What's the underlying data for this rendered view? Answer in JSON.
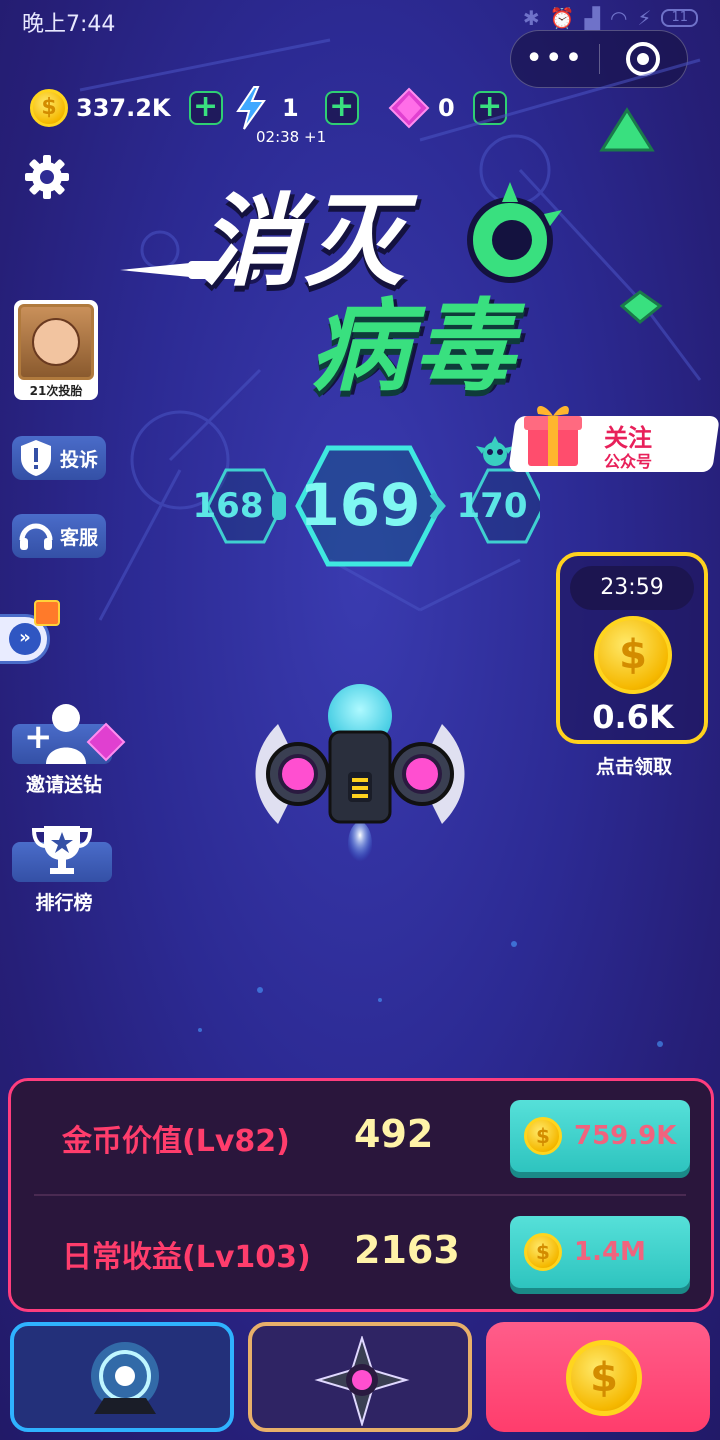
{
  "status_bar": {
    "time": "晚上7:44",
    "battery": "11"
  },
  "capsule": {
    "more": "•••"
  },
  "resources": {
    "coins": "337.2K",
    "energy": "1",
    "energy_timer": "02:38 +1",
    "gems": "0"
  },
  "title": {
    "line1": "消灭",
    "line2": "病毒"
  },
  "side": {
    "avatar_label": "21次投胎",
    "complain": "投诉",
    "service": "客服",
    "invite": "邀请送钻",
    "rank": "排行榜"
  },
  "levels": {
    "prev": "168",
    "current": "169",
    "next": "170"
  },
  "follow": {
    "line1": "关注",
    "line2": "公众号"
  },
  "daily_coin": {
    "timer": "23:59",
    "amount": "0.6K",
    "claim": "点击领取",
    "symbol": "$"
  },
  "upgrades": [
    {
      "label": "金币价值(Lv82)",
      "value": "492",
      "cost": "759.9K"
    },
    {
      "label": "日常收益(Lv103)",
      "value": "2163",
      "cost": "1.4M"
    }
  ],
  "colors": {
    "accent_green": "#39e07f",
    "panel_border": "#ff3d7e",
    "coin": "#ffd51e",
    "level": "#5ce6e6"
  }
}
